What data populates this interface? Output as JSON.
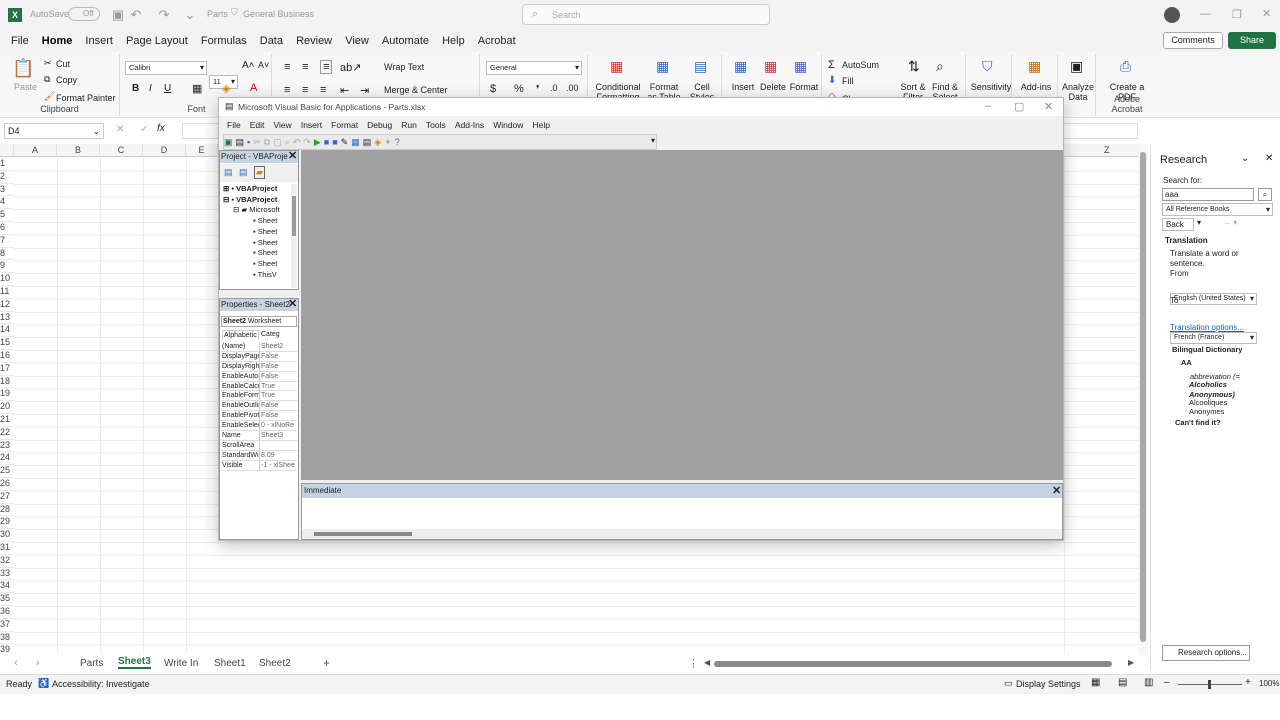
{
  "excel": {
    "autosave": "AutoSave",
    "autosave_state": "Off",
    "filename": "Parts",
    "sensitivity": "General Business",
    "search_placeholder": "Search",
    "menu": [
      "File",
      "Home",
      "Insert",
      "Page Layout",
      "Formulas",
      "Data",
      "Review",
      "View",
      "Automate",
      "Help",
      "Acrobat"
    ],
    "comments_label": "Comments",
    "share_label": "Share",
    "ribbon": {
      "paste": "Paste",
      "cut": "Cut",
      "copy": "Copy",
      "format_painter": "Format Painter",
      "clipboard": "Clipboard",
      "font_name": "Calibri",
      "font_size": "11",
      "font_group": "Font",
      "wrap_text": "Wrap Text",
      "merge_center": "Merge & Center",
      "number_format": "General",
      "conditional_formatting": "Conditional Formatting",
      "format_as_table": "Format as Table",
      "cell_styles": "Cell Styles",
      "insert": "Insert",
      "delete": "Delete",
      "format": "Format",
      "autosum": "AutoSum",
      "fill": "Fill",
      "clear": "Clear",
      "sort_filter": "Sort & Filter",
      "find_select": "Find & Select",
      "sensitivity": "Sensitivity",
      "addins": "Add-ins",
      "analyze_data": "Analyze Data",
      "create_pdf": "Create a PDF",
      "adobe_acrobat": "Adobe Acrobat"
    },
    "name_box": "D4",
    "columns": [
      "A",
      "B",
      "C",
      "D",
      "E"
    ],
    "last_column": "Z",
    "rows": [
      "1",
      "2",
      "3",
      "4",
      "5",
      "6",
      "7",
      "8",
      "9",
      "10",
      "11",
      "12",
      "13",
      "14",
      "15",
      "16",
      "17",
      "18",
      "19",
      "20",
      "21",
      "22",
      "23",
      "24",
      "25",
      "26",
      "27",
      "28",
      "29",
      "30",
      "31",
      "32",
      "33",
      "34",
      "35",
      "36",
      "37",
      "38",
      "39"
    ],
    "sheets": [
      "Parts",
      "Sheet3",
      "Write In",
      "Sheet1",
      "Sheet2"
    ],
    "active_sheet": "Sheet3",
    "status": {
      "ready": "Ready",
      "accessibility": "Accessibility: Investigate",
      "display_settings": "Display Settings",
      "zoom": "100%"
    }
  },
  "research": {
    "title": "Research",
    "search_for": "Search for:",
    "query": "aaa",
    "source": "All Reference Books",
    "back": "Back",
    "translation": "Translation",
    "translate_hint": "Translate a word or sentence.",
    "from": "From",
    "from_value": "English (United States)",
    "to": "To",
    "to_value": "French (France)",
    "translation_options": "Translation options...",
    "bilingual": "Bilingual Dictionary",
    "aa": "AA",
    "entry_italic": "abbreviation (=",
    "entry_bold": "Alcoholics Anonymous)",
    "entry_1": "Alcooliques",
    "entry_2": "Anonymes",
    "cant_find": "Can't find it?",
    "options": "Research options..."
  },
  "vbe": {
    "title": "Microsoft Visual Basic for Applications - Parts.xlsx",
    "menu": [
      "File",
      "Edit",
      "View",
      "Insert",
      "Format",
      "Debug",
      "Run",
      "Tools",
      "Add-Ins",
      "Window",
      "Help"
    ],
    "project_title": "Project - VBAProje",
    "tree": [
      "VBAProject",
      "VBAProject",
      "Microsoft",
      "Sheet",
      "Sheet",
      "Sheet",
      "Sheet",
      "Sheet",
      "ThisV"
    ],
    "props_title": "Properties - Sheet2",
    "object": "Sheet2",
    "object_type": "Worksheet",
    "tab_alpha": "Alphabetic",
    "tab_categ": "Categ",
    "props": [
      {
        "n": "(Name)",
        "v": "Sheet2"
      },
      {
        "n": "DisplayPage",
        "v": "False"
      },
      {
        "n": "DisplayRight",
        "v": "False"
      },
      {
        "n": "EnableAutoF",
        "v": "False"
      },
      {
        "n": "EnableCalcu",
        "v": "True"
      },
      {
        "n": "EnableForm",
        "v": "True"
      },
      {
        "n": "EnableOutlin",
        "v": "False"
      },
      {
        "n": "EnablePivot",
        "v": "False"
      },
      {
        "n": "EnableSelec",
        "v": "0 - xlNoRe"
      },
      {
        "n": "Name",
        "v": "Sheet3"
      },
      {
        "n": "ScrollArea",
        "v": ""
      },
      {
        "n": "StandardWi",
        "v": "8.09"
      },
      {
        "n": "Visible",
        "v": "-1 - xlShee"
      }
    ],
    "immediate": "Immediate"
  },
  "colors": {
    "excel_green": "#217346",
    "vbe_gray": "#a0a0a0",
    "immediate_title": "#c5d3e3"
  }
}
